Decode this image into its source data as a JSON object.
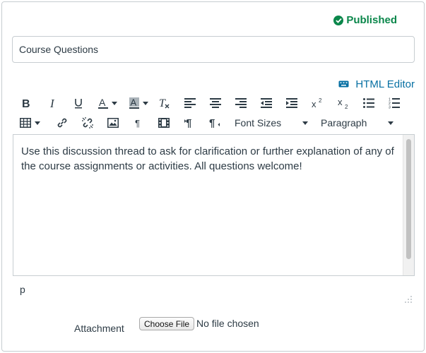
{
  "status": {
    "label": "Published",
    "color": "#0b874b"
  },
  "title_field": {
    "value": "Course Questions"
  },
  "editor": {
    "html_editor_label": "HTML Editor",
    "font_sizes_label": "Font Sizes",
    "paragraph_label": "Paragraph",
    "body_text": "Use this discussion thread to ask for clarification or further explanation of any of the course assignments or activities. All questions welcome!",
    "path_indicator": "p",
    "accent_color": "#0770a3"
  },
  "attachment": {
    "label": "Attachment",
    "button_label": "Choose File",
    "file_status": "No file chosen"
  },
  "toolbar_icons": [
    "bold-icon",
    "italic-icon",
    "underline-icon",
    "text-color-icon",
    "background-color-icon",
    "clear-formatting-icon",
    "align-left-icon",
    "align-center-icon",
    "align-right-icon",
    "outdent-icon",
    "indent-icon",
    "superscript-icon",
    "subscript-icon",
    "bullet-list-icon",
    "numbered-list-icon",
    "table-icon",
    "link-icon",
    "unlink-icon",
    "image-icon",
    "paragraph-mark-icon",
    "media-icon",
    "ltr-icon",
    "rtl-icon"
  ]
}
